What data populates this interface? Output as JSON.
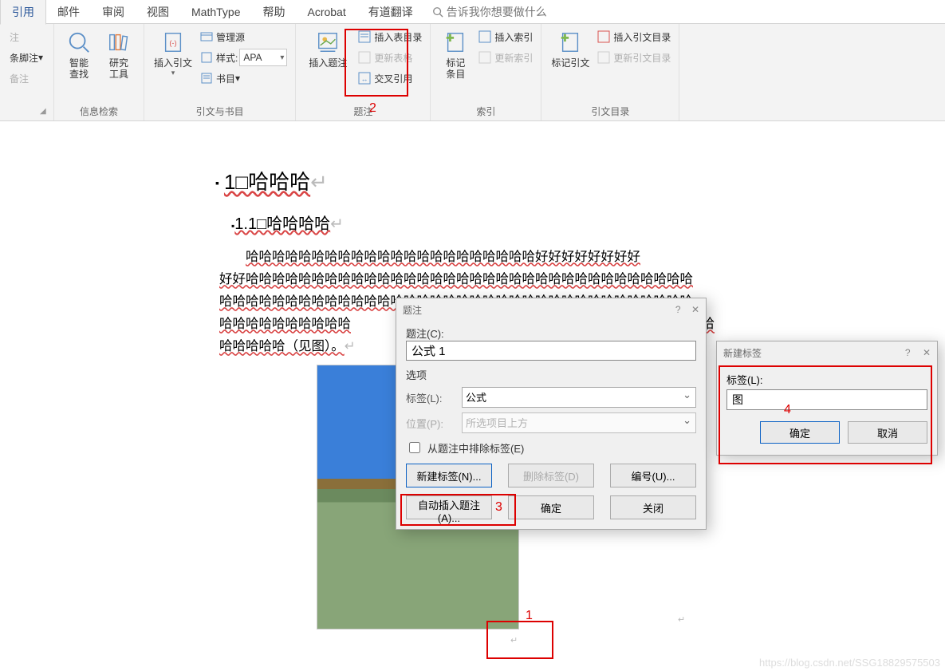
{
  "tabs": {
    "t0": "引用",
    "t1": "邮件",
    "t2": "审阅",
    "t3": "视图",
    "t4": "MathType",
    "t5": "帮助",
    "t6": "Acrobat",
    "t7": "有道翻译",
    "tellme": "告诉我你想要做什么"
  },
  "ribbon": {
    "group0": {
      "title": "",
      "label_note": "注",
      "label_footnote": "条脚注",
      "label_note2": "备注"
    },
    "group1": {
      "title": "信息检索",
      "btn_smart": "智能\n查找",
      "btn_research": "研究\n工具"
    },
    "group2": {
      "title": "引文与书目",
      "insert_cite": "插入引文",
      "manage_src": "管理源",
      "style_label": "样式:",
      "style_value": "APA",
      "biblio": "书目"
    },
    "group3": {
      "title": "题注",
      "insert_caption": "插入题注",
      "insert_toc": "插入表目录",
      "update_table": "更新表格",
      "cross_ref": "交叉引用"
    },
    "group4": {
      "title": "索引",
      "mark_entry": "标记\n条目",
      "insert_index": "插入索引",
      "update_index": "更新索引"
    },
    "group5": {
      "title": "引文目录",
      "mark_cite": "标记引文",
      "insert_auth": "插入引文目录",
      "update_auth": "更新引文目录"
    }
  },
  "doc": {
    "h1": "1□哈哈哈",
    "h2": "1.1□哈哈哈哈",
    "para1": "哈哈哈哈哈哈哈哈哈哈哈哈哈哈哈哈哈哈哈哈哈哈好好好好好好好好",
    "para2": "好好哈哈哈哈哈哈哈哈哈哈哈哈哈哈哈哈哈哈哈哈哈哈哈哈哈哈哈哈哈哈哈哈哈哈",
    "para3": "哈哈哈哈哈哈哈哈哈哈哈哈哈哈哈哈哈哈哈哈哈哈哈哈哈哈哈哈哈哈哈哈哈哈哈哈",
    "para4_a": "哈哈哈哈哈哈哈哈哈哈",
    "para4_b": "哈哈哈哈",
    "para5": "哈哈哈哈哈（见图）。"
  },
  "dialog1": {
    "title": "题注",
    "caption_label": "题注(C):",
    "caption_value": "公式 1",
    "options_heading": "选项",
    "label_label": "标签(L):",
    "label_value": "公式",
    "position_label": "位置(P):",
    "position_value": "所选项目上方",
    "exclude_label": "从题注中排除标签(E)",
    "btn_new": "新建标签(N)...",
    "btn_del": "删除标签(D)",
    "btn_num": "编号(U)...",
    "btn_auto": "自动插入题注(A)...",
    "btn_ok": "确定",
    "btn_close": "关闭"
  },
  "dialog2": {
    "title": "新建标签",
    "label_label": "标签(L):",
    "label_value": "图",
    "btn_ok": "确定",
    "btn_cancel": "取消"
  },
  "annotations": {
    "n1": "1",
    "n2": "2",
    "n3": "3",
    "n4": "4"
  },
  "watermark": "https://blog.csdn.net/SSG18829575503"
}
